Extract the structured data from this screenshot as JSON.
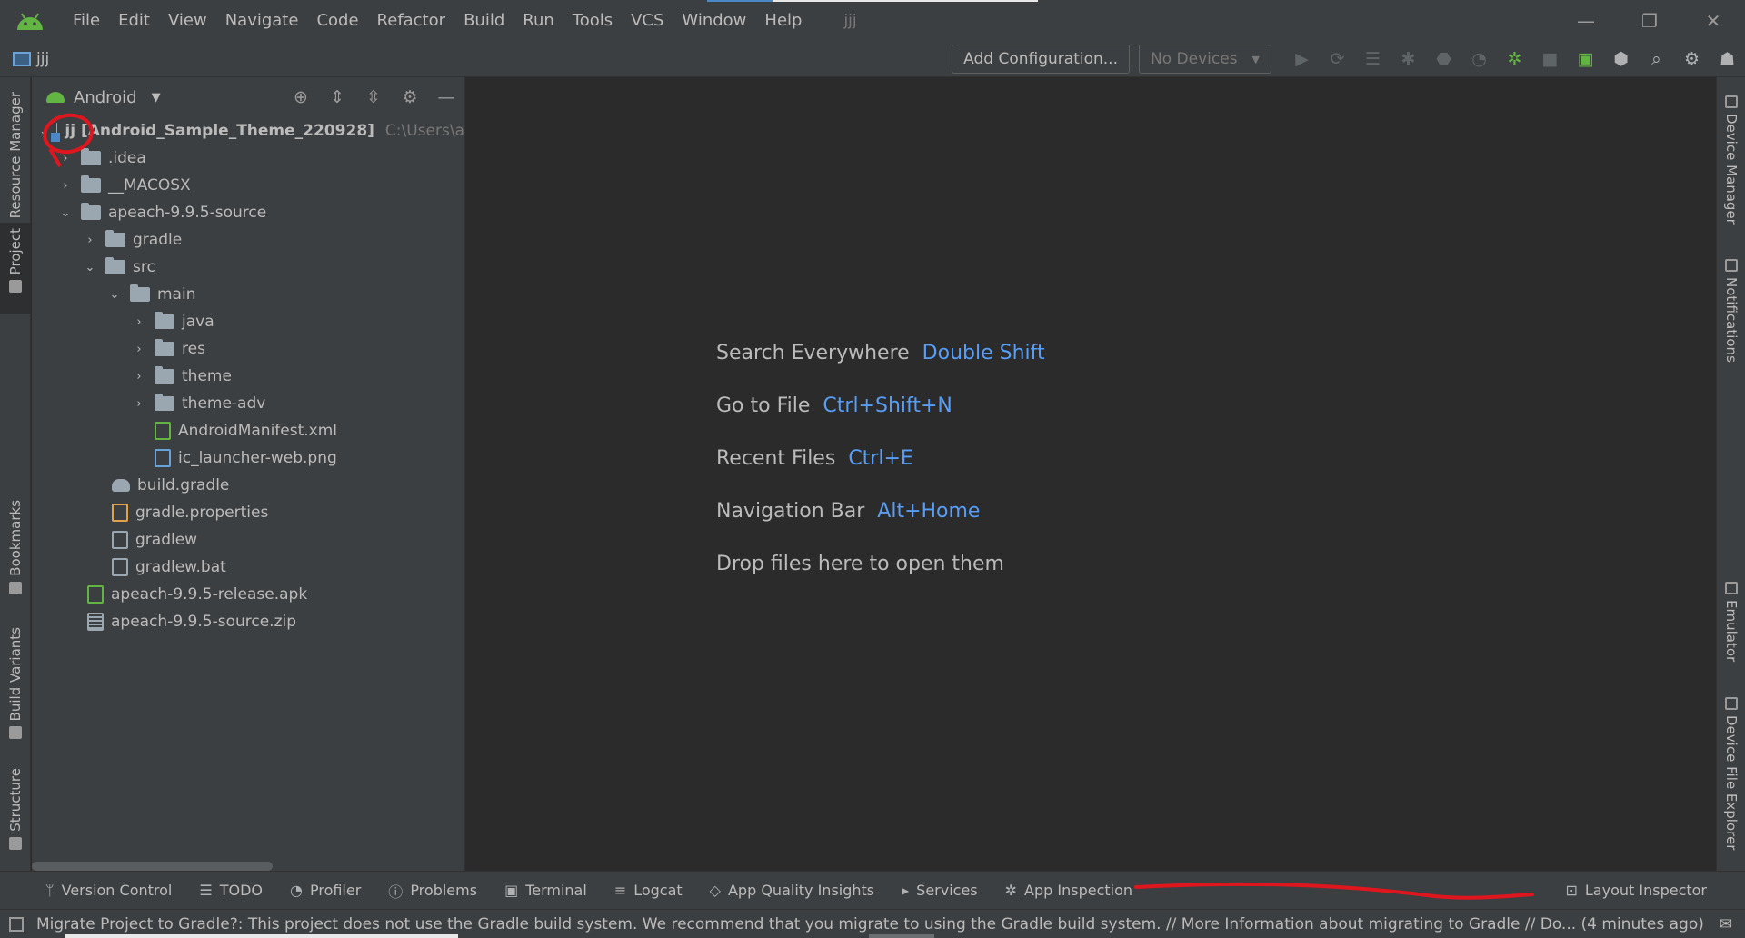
{
  "menubar": {
    "items": [
      "File",
      "Edit",
      "View",
      "Navigate",
      "Code",
      "Refactor",
      "Build",
      "Run",
      "Tools",
      "VCS",
      "Window",
      "Help"
    ],
    "project_title": "jjj",
    "minimize": "—",
    "restore": "❐",
    "close": "✕"
  },
  "toolbar": {
    "breadcrumb": "jjj",
    "add_configuration": "Add Configuration...",
    "devices": "No Devices",
    "devices_caret": "▼"
  },
  "left_stripe": {
    "tabs": [
      "Resource Manager",
      "Project",
      "Bookmarks",
      "Build Variants",
      "Structure"
    ]
  },
  "right_stripe": {
    "tabs": [
      "Device Manager",
      "Notifications",
      "Emulator",
      "Device File Explorer"
    ]
  },
  "project_panel": {
    "view_name": "Android",
    "tree": [
      {
        "label": "jj [Android_Sample_Theme_220928]",
        "path": "C:\\Users\\a",
        "expanded": true
      },
      {
        "label": ".idea"
      },
      {
        "label": "__MACOSX"
      },
      {
        "label": "apeach-9.9.5-source",
        "expanded": true
      },
      {
        "label": "gradle"
      },
      {
        "label": "src",
        "expanded": true
      },
      {
        "label": "main",
        "expanded": true
      },
      {
        "label": "java"
      },
      {
        "label": "res"
      },
      {
        "label": "theme"
      },
      {
        "label": "theme-adv"
      },
      {
        "label": "AndroidManifest.xml"
      },
      {
        "label": "ic_launcher-web.png"
      },
      {
        "label": "build.gradle"
      },
      {
        "label": "gradle.properties"
      },
      {
        "label": "gradlew"
      },
      {
        "label": "gradlew.bat"
      },
      {
        "label": "apeach-9.9.5-release.apk"
      },
      {
        "label": "apeach-9.9.5-source.zip"
      }
    ]
  },
  "editor": {
    "hints": [
      {
        "label": "Search Everywhere",
        "key": "Double Shift"
      },
      {
        "label": "Go to File",
        "key": "Ctrl+Shift+N"
      },
      {
        "label": "Recent Files",
        "key": "Ctrl+E"
      },
      {
        "label": "Navigation Bar",
        "key": "Alt+Home"
      },
      {
        "label": "Drop files here to open them",
        "key": ""
      }
    ]
  },
  "bottombar": {
    "tabs": [
      "Version Control",
      "TODO",
      "Profiler",
      "Problems",
      "Terminal",
      "Logcat",
      "App Quality Insights",
      "Services",
      "App Inspection"
    ],
    "right_tab": "Layout Inspector"
  },
  "statusbar": {
    "message": "Migrate Project to Gradle?: This project does not use the Gradle build system. We recommend that you migrate to using the Gradle build system. // More Information about migrating to Gradle // Do... (4 minutes ago)"
  },
  "colors": {
    "background": "#2b2b2b",
    "panel": "#3c3f41",
    "accent_key": "#589df6",
    "annotation_red": "#e0161e",
    "android_green": "#62b543"
  }
}
